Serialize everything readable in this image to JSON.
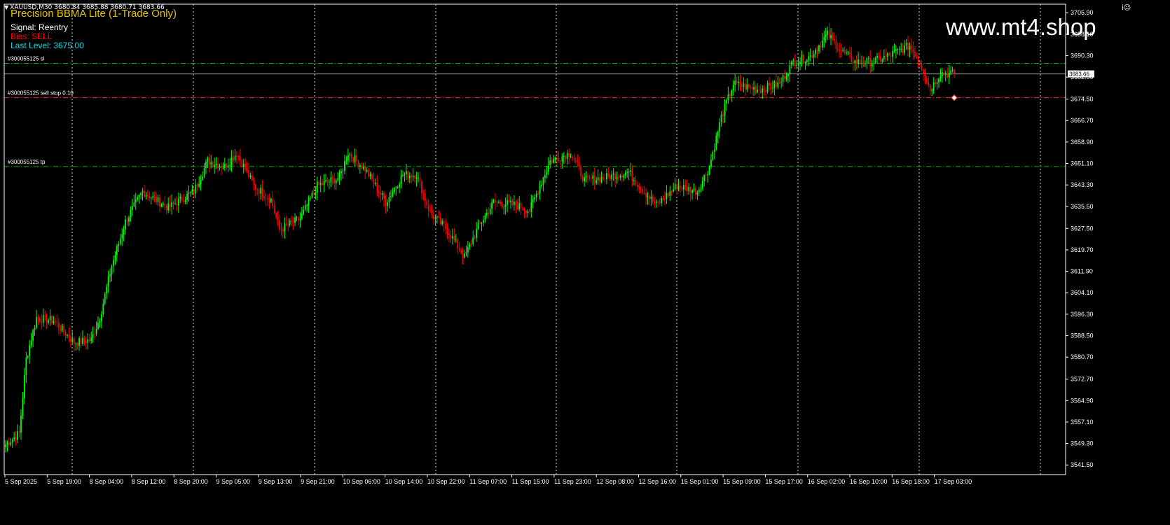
{
  "header": {
    "symbol_info": "XAUUSD,M30  3680.84 3685.88 3680.71 3683.66",
    "ea_title": "Precision BBMA Lite (1-Trade Only)",
    "signal_text": "Signal: Reentry",
    "bias_text": "Bias: SELL",
    "last_level_text": "Last Level: 3675.00",
    "watermark": "www.mt4.shop",
    "corner_icon": "i☺"
  },
  "colors": {
    "background": "#000000",
    "bull": "#00ff00",
    "bear": "#ff0000",
    "grid": "#ffffff",
    "sl_line": "#00b400",
    "tp_line": "#00b400",
    "pending_line": "#ff3030",
    "bid_line": "#a0a8b8",
    "title": "#e6c200",
    "bias": "#ff0000",
    "last_level": "#00e0e0"
  },
  "order_lines": [
    {
      "label": "#300055125 sl",
      "price": 3687.5,
      "kind": "sl"
    },
    {
      "label": "#300055125 sell stop 0.10",
      "price": 3675.0,
      "kind": "pending"
    },
    {
      "label": "#300055125 tp",
      "price": 3650.0,
      "kind": "tp"
    }
  ],
  "current_price": {
    "value": 3683.66,
    "label": "3683.66"
  },
  "price_axis": {
    "min": 3538,
    "max": 3709,
    "labels": [
      "3705.90",
      "3698.10",
      "3690.30",
      "3682.50",
      "3674.50",
      "3666.70",
      "3658.90",
      "3651.10",
      "3643.30",
      "3635.50",
      "3627.50",
      "3619.70",
      "3611.90",
      "3604.10",
      "3596.30",
      "3588.50",
      "3580.70",
      "3572.70",
      "3564.90",
      "3557.10",
      "3549.30",
      "3541.50"
    ]
  },
  "time_axis": {
    "labels": [
      "5 Sep 2025",
      "5 Sep 19:00",
      "8 Sep 04:00",
      "8 Sep 12:00",
      "8 Sep 20:00",
      "9 Sep 05:00",
      "9 Sep 13:00",
      "9 Sep 21:00",
      "10 Sep 06:00",
      "10 Sep 14:00",
      "10 Sep 22:00",
      "11 Sep 07:00",
      "11 Sep 15:00",
      "11 Sep 23:00",
      "12 Sep 08:00",
      "12 Sep 16:00",
      "15 Sep 01:00",
      "15 Sep 09:00",
      "15 Sep 17:00",
      "16 Sep 02:00",
      "16 Sep 10:00",
      "16 Sep 18:00",
      "17 Sep 03:00"
    ]
  },
  "chart_data": {
    "type": "candlestick",
    "symbol": "XAUUSD",
    "timeframe": "M30",
    "ylim": [
      3538,
      3709
    ],
    "path_anchors": [
      [
        0,
        3549
      ],
      [
        8,
        3553
      ],
      [
        12,
        3580
      ],
      [
        18,
        3595
      ],
      [
        28,
        3594
      ],
      [
        40,
        3586
      ],
      [
        50,
        3587
      ],
      [
        55,
        3595
      ],
      [
        62,
        3614
      ],
      [
        70,
        3630
      ],
      [
        80,
        3641
      ],
      [
        95,
        3635
      ],
      [
        110,
        3641
      ],
      [
        118,
        3652
      ],
      [
        128,
        3650
      ],
      [
        135,
        3655
      ],
      [
        145,
        3643
      ],
      [
        155,
        3638
      ],
      [
        160,
        3627
      ],
      [
        172,
        3631
      ],
      [
        182,
        3643
      ],
      [
        195,
        3646
      ],
      [
        200,
        3655
      ],
      [
        210,
        3649
      ],
      [
        222,
        3637
      ],
      [
        232,
        3647
      ],
      [
        240,
        3647
      ],
      [
        248,
        3633
      ],
      [
        258,
        3627
      ],
      [
        268,
        3617
      ],
      [
        276,
        3628
      ],
      [
        285,
        3637
      ],
      [
        298,
        3636
      ],
      [
        306,
        3634
      ],
      [
        318,
        3652
      ],
      [
        330,
        3655
      ],
      [
        338,
        3645
      ],
      [
        350,
        3646
      ],
      [
        364,
        3648
      ],
      [
        370,
        3643
      ],
      [
        380,
        3636
      ],
      [
        392,
        3643
      ],
      [
        404,
        3641
      ],
      [
        411,
        3650
      ],
      [
        418,
        3668
      ],
      [
        425,
        3680
      ],
      [
        440,
        3678
      ],
      [
        452,
        3680
      ],
      [
        460,
        3688
      ],
      [
        470,
        3690
      ],
      [
        480,
        3698
      ],
      [
        488,
        3692
      ],
      [
        496,
        3688
      ],
      [
        506,
        3688
      ],
      [
        515,
        3690
      ],
      [
        528,
        3694
      ],
      [
        534,
        3688
      ],
      [
        540,
        3678
      ],
      [
        546,
        3684
      ],
      [
        554,
        3683.66
      ]
    ]
  }
}
